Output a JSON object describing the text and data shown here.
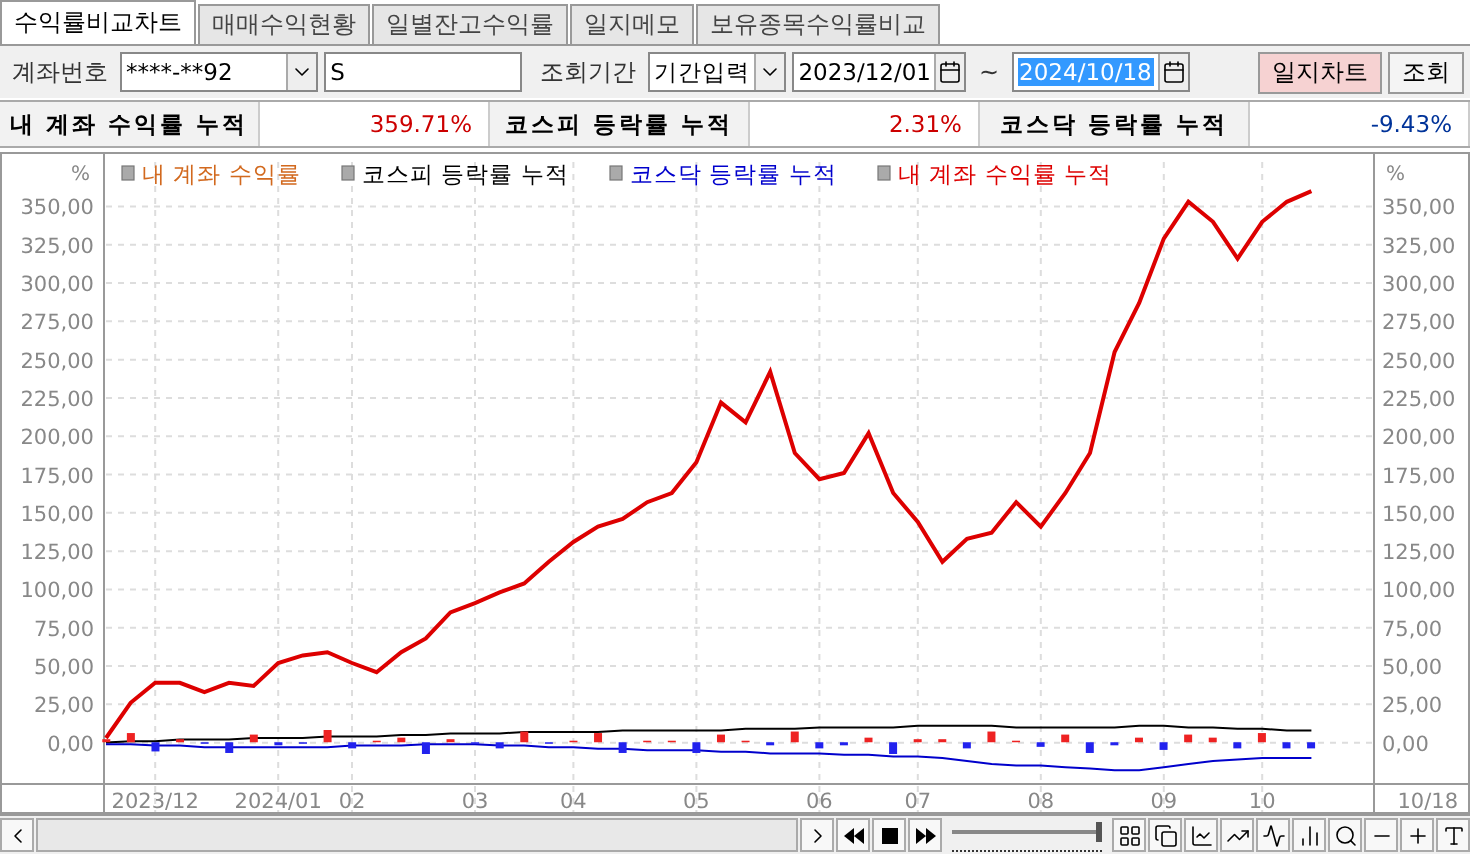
{
  "tabs": [
    {
      "label": "수익률비교차트",
      "selected": true
    },
    {
      "label": "매매수익현황",
      "selected": false
    },
    {
      "label": "일별잔고수익률",
      "selected": false
    },
    {
      "label": "일지메모",
      "selected": false
    },
    {
      "label": "보유종목수익률비교",
      "selected": false
    }
  ],
  "filter": {
    "account_label": "계좌번호",
    "account_value": "****-**92",
    "name_value": "S",
    "period_label": "조회기간",
    "period_mode": "기간입력",
    "date_from": "2023/12/01",
    "separator": "~",
    "date_to": "2024/10/18",
    "date_to_selected": true,
    "journal_button": "일지차트",
    "search_button": "조회"
  },
  "summary": [
    {
      "label": "내 계좌 수익률 누적",
      "value": "359.71%",
      "color": "#cc0000"
    },
    {
      "label": "코스피 등락률 누적",
      "value": "2.31%",
      "color": "#cc0000"
    },
    {
      "label": "코스닥 등락률 누적",
      "value": "-9.43%",
      "color": "#003399"
    }
  ],
  "zoom_slider": {
    "level": 1
  },
  "chart": {
    "unit_left": "%",
    "unit_right": "%",
    "end_label": "10/18",
    "daily_bars": {
      "name": "내 계좌 수익률",
      "color": "#d2691e"
    },
    "chart_data": {
      "type": "line",
      "grid": true,
      "ylim": [
        -27,
        379
      ],
      "categories": [
        null,
        null,
        "2023/12",
        null,
        null,
        null,
        null,
        "2024/01",
        null,
        null,
        "02",
        null,
        null,
        null,
        null,
        "03",
        null,
        null,
        null,
        "04",
        null,
        null,
        null,
        null,
        "05",
        null,
        null,
        null,
        null,
        "06",
        null,
        null,
        null,
        "07",
        null,
        null,
        null,
        null,
        "08",
        null,
        null,
        null,
        null,
        "09",
        null,
        null,
        null,
        "10",
        null,
        null
      ],
      "yticks": [
        {
          "value": 0,
          "label": "0,00"
        },
        {
          "value": 25,
          "label": "25,00"
        },
        {
          "value": 50,
          "label": "50,00"
        },
        {
          "value": 75,
          "label": "75,00"
        },
        {
          "value": 100,
          "label": "100,00"
        },
        {
          "value": 125,
          "label": "125,00"
        },
        {
          "value": 150,
          "label": "150,00"
        },
        {
          "value": 175,
          "label": "175,00"
        },
        {
          "value": 200,
          "label": "200,00"
        },
        {
          "value": 225,
          "label": "225,00"
        },
        {
          "value": 250,
          "label": "250,00"
        },
        {
          "value": 275,
          "label": "275,00"
        },
        {
          "value": 300,
          "label": "300,00"
        },
        {
          "value": 325,
          "label": "325,00"
        },
        {
          "value": 350,
          "label": "350,00"
        }
      ],
      "series": [
        {
          "name": "코스피 등락률 누적",
          "color": "#000000",
          "values": [
            0,
            1,
            1,
            2,
            2,
            2,
            3,
            3,
            3,
            4,
            4,
            4,
            5,
            5,
            6,
            6,
            6,
            7,
            7,
            7,
            7,
            8,
            8,
            8,
            8,
            8,
            9,
            9,
            9,
            10,
            10,
            10,
            10,
            11,
            11,
            11,
            11,
            10,
            10,
            10,
            10,
            10,
            11,
            11,
            10,
            10,
            9,
            9,
            8,
            8
          ]
        },
        {
          "name": "코스닥 등락률 누적",
          "color": "#0000cc",
          "values": [
            -1,
            -1,
            -2,
            -2,
            -3,
            -3,
            -3,
            -3,
            -3,
            -3,
            -2,
            -2,
            -2,
            -1,
            -1,
            -1,
            -2,
            -2,
            -3,
            -3,
            -4,
            -4,
            -5,
            -5,
            -5,
            -6,
            -6,
            -7,
            -7,
            -7,
            -8,
            -8,
            -9,
            -9,
            -10,
            -12,
            -14,
            -15,
            -15,
            -16,
            -17,
            -18,
            -18,
            -16,
            -14,
            -12,
            -11,
            -10,
            -10,
            -10
          ]
        },
        {
          "name": "내 계좌 수익률 누적",
          "color": "#dd0000",
          "values": [
            3,
            26,
            39,
            39,
            33,
            39,
            37,
            52,
            57,
            59,
            52,
            46,
            59,
            68,
            85,
            91,
            98,
            104,
            118,
            131,
            141,
            146,
            157,
            163,
            183,
            222,
            209,
            242,
            189,
            172,
            176,
            202,
            163,
            144,
            118,
            133,
            137,
            157,
            141,
            163,
            189,
            255,
            287,
            329,
            353,
            340,
            316,
            340,
            353,
            360
          ]
        }
      ]
    }
  }
}
